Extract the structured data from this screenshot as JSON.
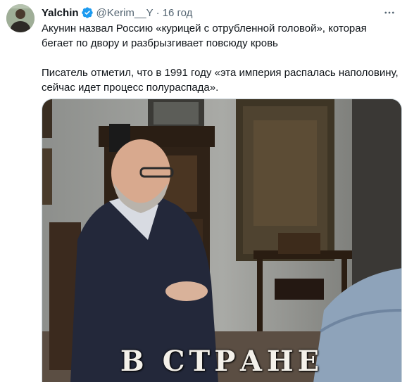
{
  "tweet": {
    "author_name": "Yalchin",
    "handle": "@Kerim__Y",
    "separator": "·",
    "time": "16 год",
    "text_p1": "Акунин назвал Россию «курицей с отрубленной головой», которая бегает по двору и разбрызгивает повсюду кровь",
    "text_p2": "Писатель отметил, что в 1991 году «эта империя распалась наполовину, сейчас идет процесс полураспада»."
  },
  "media": {
    "caption": "В СТРАНЕ"
  },
  "icons": {
    "verified": "verified-badge-icon",
    "more": "more-options-icon"
  },
  "colors": {
    "verified_blue": "#1d9bf0",
    "secondary_text": "#536471",
    "primary_text": "#0f1419"
  }
}
